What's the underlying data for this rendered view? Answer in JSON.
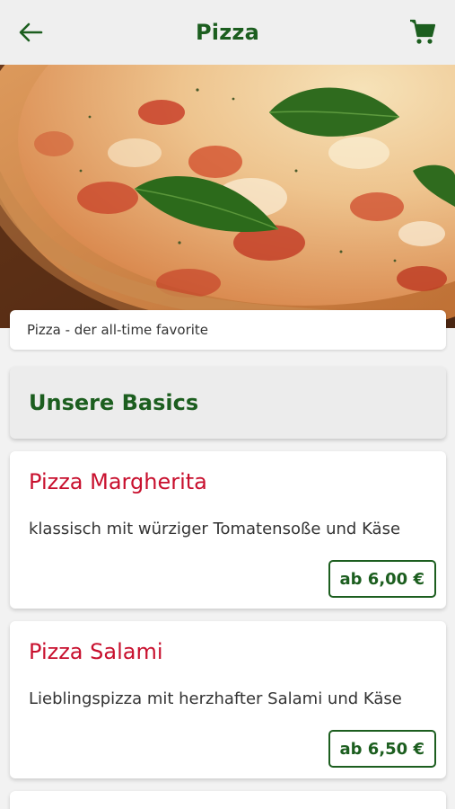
{
  "header": {
    "title": "Pizza",
    "back_icon": "arrow-left-icon",
    "cart_icon": "shopping-cart-icon"
  },
  "hero": {
    "image": "pizza-margherita-photo"
  },
  "caption": {
    "text": "Pizza - der all-time favorite"
  },
  "section": {
    "title": "Unsere Basics"
  },
  "products": [
    {
      "name": "Pizza Margherita",
      "description": "klassisch mit würziger Tomatensoße und Käse",
      "price": "ab 6,00 €"
    },
    {
      "name": "Pizza Salami",
      "description": "Lieblingspizza mit herzhafter Salami und Käse",
      "price": "ab 6,50 €"
    }
  ],
  "colors": {
    "brand_green": "#1c5e1f",
    "product_red": "#c8102e",
    "background": "#f2f2f2"
  }
}
